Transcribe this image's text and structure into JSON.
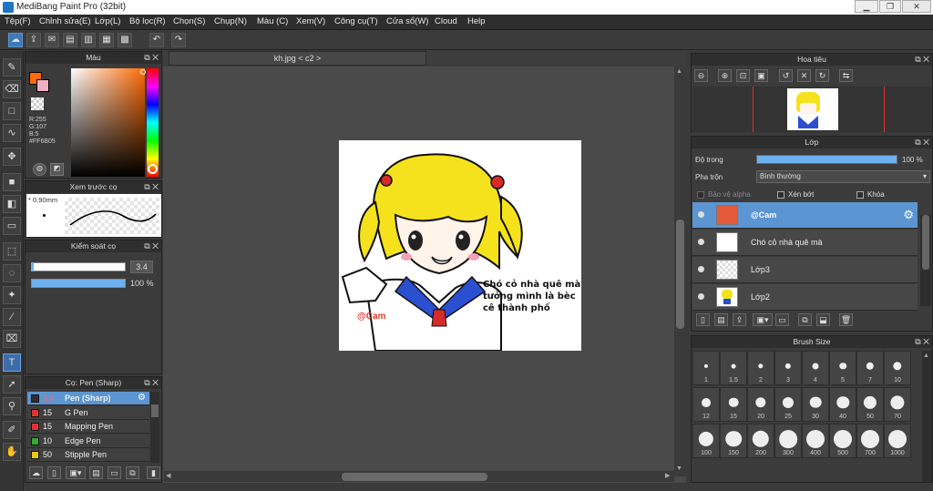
{
  "window": {
    "title": "MediBang Paint Pro (32bit)",
    "buttons": [
      "▁",
      "❐",
      "✕"
    ]
  },
  "menu": [
    "Tệp(F)",
    "Chỉnh sửa(E)",
    "Lớp(L)",
    "Bộ lọc(R)",
    "Chọn(S)",
    "Chụp(N)",
    "Màu (C)",
    "Xem(V)",
    "Công cụ(T)",
    "Cửa sổ(W)",
    "Cloud",
    "Help"
  ],
  "color_panel": {
    "title": "Màu",
    "r": "R:255",
    "g": "G:107",
    "b": "B:5",
    "hex": "#FF6B05",
    "primary": "#ff6b05",
    "secondary": "#ffffff"
  },
  "brush_preview": {
    "title": "Xem trước cọ",
    "size": "0.90mm"
  },
  "brush_control": {
    "title": "Kiểm soát cọ",
    "size_value": "3.4",
    "opacity_value": "100 %",
    "size_fraction": 0.95,
    "opacity_fraction": 1.0
  },
  "brush_list": {
    "title": "Cọ: Pen (Sharp)",
    "items": [
      {
        "size": "3.4",
        "name": "Pen (Sharp)",
        "color": "#2e2e2e",
        "selected": true
      },
      {
        "size": "15",
        "name": "G Pen",
        "color": "#e53030",
        "selected": false
      },
      {
        "size": "15",
        "name": "Mapping Pen",
        "color": "#e53030",
        "selected": false
      },
      {
        "size": "10",
        "name": "Edge Pen",
        "color": "#33aa33",
        "selected": false
      },
      {
        "size": "50",
        "name": "Stipple Pen",
        "color": "#e8c51f",
        "selected": false
      }
    ]
  },
  "document": {
    "tab": "kh.jpg < c2 >",
    "caption_lines": [
      "Chó cỏ nhà quê mà",
      "tưởng mình là bèc",
      "cê thành phố"
    ],
    "watermark": "@Cam"
  },
  "navigator": {
    "title": "Hoa tiêu"
  },
  "layers": {
    "title": "Lớp",
    "opacity_label": "Độ trong",
    "opacity_value": "100 %",
    "opacity_fraction": 1.0,
    "blend_label": "Pha trộn",
    "blend_value": "Bình thường",
    "protect_alpha": "Bảo vệ alpha",
    "clipping": "Xén bớt",
    "lock": "Khóa",
    "items": [
      {
        "name": "@Cam",
        "selected": true
      },
      {
        "name": "Chó cỏ nhà quê mà",
        "selected": false
      },
      {
        "name": "Lớp3",
        "selected": false
      },
      {
        "name": "Lớp2",
        "selected": false
      }
    ]
  },
  "brush_size": {
    "title": "Brush Size",
    "sizes": [
      "1",
      "1.5",
      "2",
      "3",
      "4",
      "5",
      "7",
      "10",
      "12",
      "15",
      "20",
      "25",
      "30",
      "40",
      "50",
      "70",
      "100",
      "150",
      "200",
      "300",
      "400",
      "500",
      "700",
      "1000"
    ]
  }
}
